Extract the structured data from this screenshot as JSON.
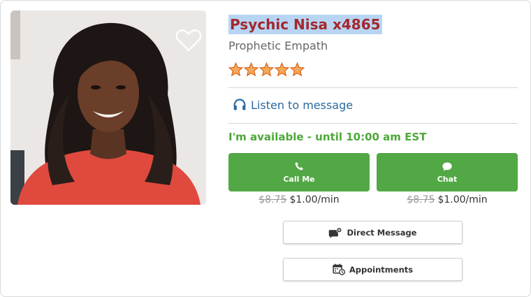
{
  "advisor": {
    "name": "Psychic Nisa x4865",
    "specialty": "Prophetic Empath",
    "rating_stars": 5,
    "listen_label": "Listen to message",
    "availability": "I'm available - until 10:00 am EST"
  },
  "actions": {
    "call": {
      "label": "Call Me",
      "old_price": "$8.75",
      "price": "$1.00/min"
    },
    "chat": {
      "label": "Chat",
      "old_price": "$8.75",
      "price": "$1.00/min"
    },
    "direct_message_label": "Direct Message",
    "appointments_label": "Appointments"
  },
  "colors": {
    "name": "#a3282c",
    "name_highlight": "#b7d5f3",
    "green": "#52a844",
    "link": "#2a6aa0",
    "star": "#f08a24"
  },
  "icons": {
    "favorite": "heart-icon",
    "listen": "headphones-icon",
    "call": "phone-icon",
    "chat": "chat-bubble-icon",
    "direct_message": "message-icon",
    "appointments": "calendar-clock-icon"
  }
}
